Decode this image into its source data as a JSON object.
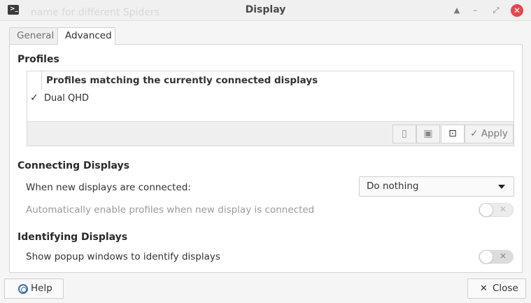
{
  "window": {
    "title": "Display",
    "background_text": "name for different Spiders",
    "app_icon_glyph": ">_"
  },
  "tabs": [
    {
      "label": "General",
      "active": false
    },
    {
      "label": "Advanced",
      "active": true
    }
  ],
  "profiles": {
    "section_title": "Profiles",
    "header": "Profiles matching the currently connected displays",
    "items": [
      {
        "name": "Dual QHD",
        "checked": true
      }
    ],
    "toolbar": {
      "apply_label": "Apply",
      "icons": [
        "clipboard-icon",
        "save-icon",
        "new-profile-icon",
        "checkmark-icon"
      ]
    }
  },
  "connecting": {
    "section_title": "Connecting Displays",
    "new_displays_label": "When new displays are connected:",
    "new_displays_value": "Do nothing",
    "auto_enable_label": "Automatically enable profiles when new display is connected",
    "auto_enable_on": false
  },
  "identifying": {
    "section_title": "Identifying Displays",
    "popup_label": "Show popup windows to identify displays",
    "popup_on": false
  },
  "footer": {
    "help_label": "Help",
    "close_label": "Close"
  },
  "colors": {
    "close_button": "#e8454f",
    "help_icon": "#3a6fb0"
  }
}
